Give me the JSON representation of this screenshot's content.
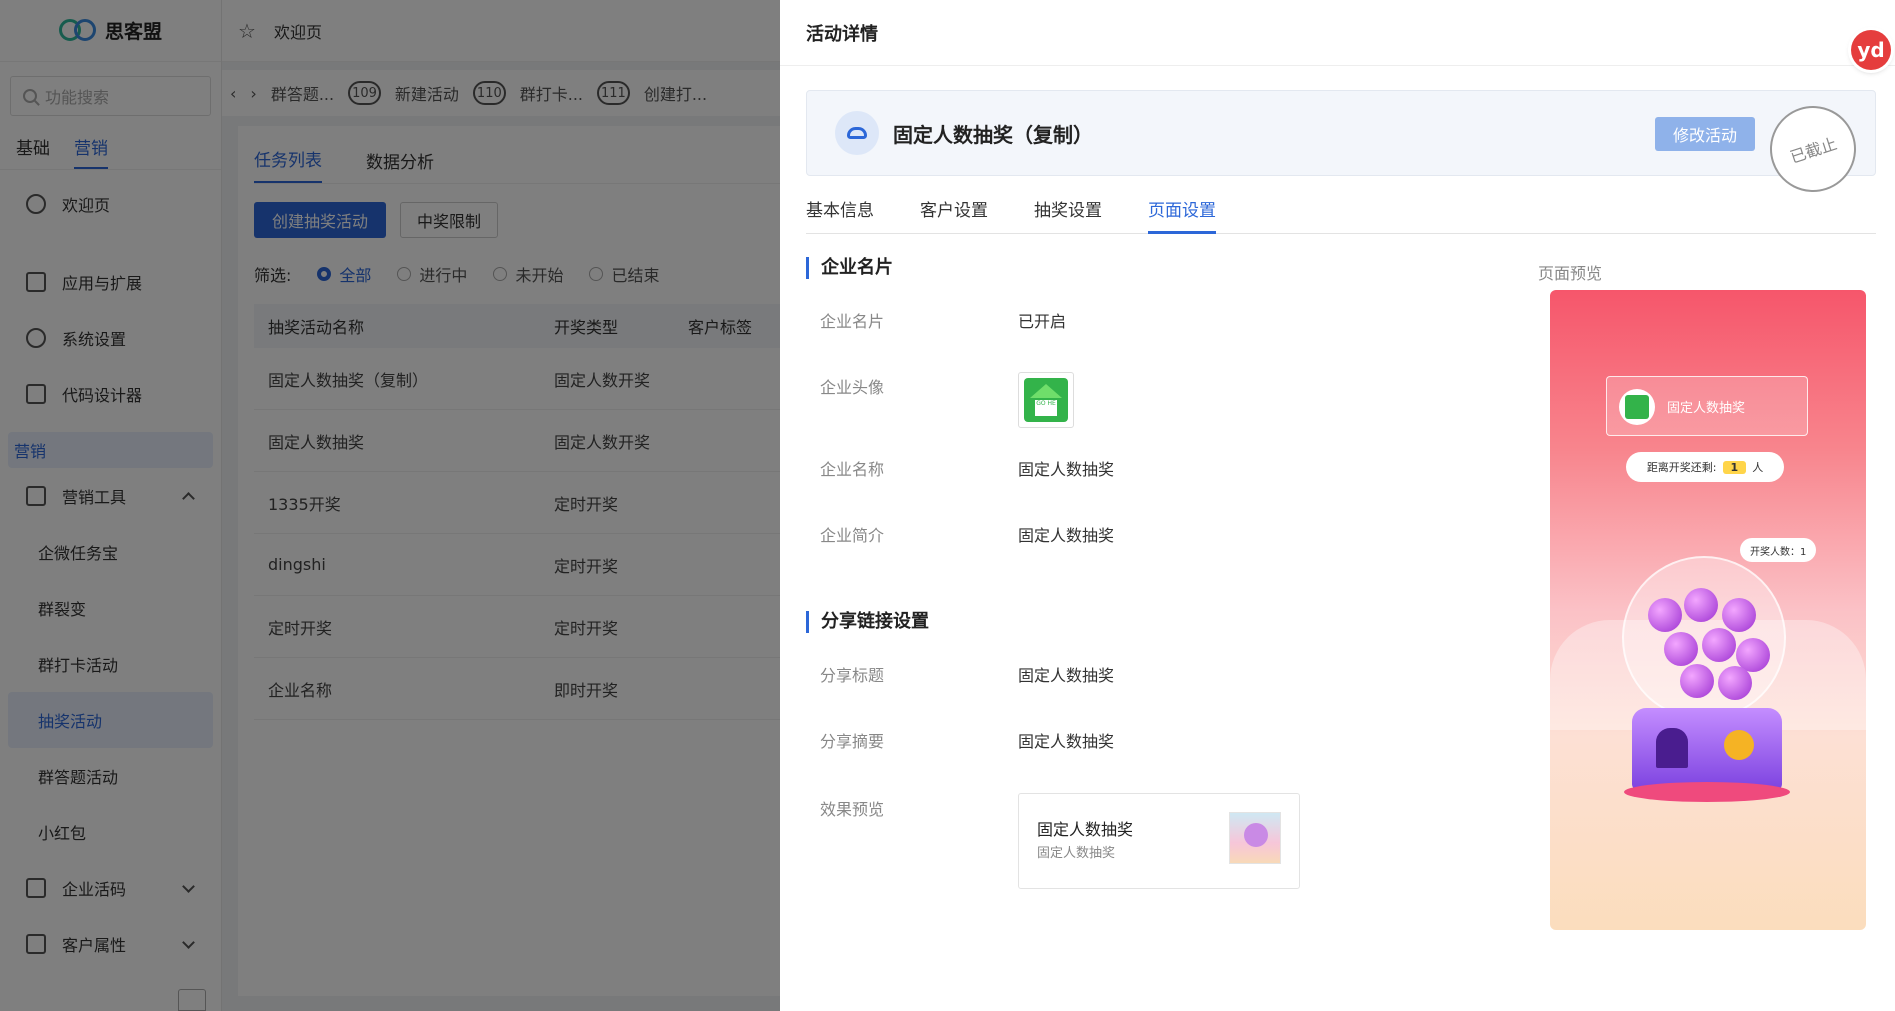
{
  "app": {
    "logo_text": "思客盟"
  },
  "sidebar": {
    "search_placeholder": "功能搜索",
    "tabs": [
      {
        "label": "基础"
      },
      {
        "label": "营销"
      }
    ],
    "welcome": "欢迎页",
    "items": [
      {
        "label": "应用与扩展"
      },
      {
        "label": "系统设置"
      },
      {
        "label": "代码设计器"
      }
    ],
    "group_label": "营销",
    "marketing_tools": "营销工具",
    "sub_items": [
      {
        "label": "企微任务宝"
      },
      {
        "label": "群裂变"
      },
      {
        "label": "群打卡活动"
      },
      {
        "label": "抽奖活动"
      },
      {
        "label": "群答题活动"
      },
      {
        "label": "小红包"
      }
    ],
    "enterprise_active": "企业活码",
    "customer_attr": "客户属性"
  },
  "topbar": {
    "welcome": "欢迎页"
  },
  "tabsbar": {
    "tabs": [
      {
        "label": "群答题...",
        "badge": "109"
      },
      {
        "label": "新建活动",
        "badge": "110"
      },
      {
        "label": "群打卡...",
        "badge": "111"
      },
      {
        "label": "创建打..."
      }
    ]
  },
  "list": {
    "tabs": [
      "任务列表",
      "数据分析"
    ],
    "create_button": "创建抽奖活动",
    "limit_button": "中奖限制",
    "filter_label": "筛选:",
    "filters": [
      "全部",
      "进行中",
      "未开始",
      "已结束"
    ],
    "headers": [
      "抽奖活动名称",
      "开奖类型",
      "客户标签"
    ],
    "rows": [
      [
        "固定人数抽奖（复制）",
        "固定人数开奖"
      ],
      [
        "固定人数抽奖",
        "固定人数开奖"
      ],
      [
        "1335开奖",
        "定时开奖"
      ],
      [
        "dingshi",
        "定时开奖"
      ],
      [
        "定时开奖",
        "定时开奖"
      ],
      [
        "企业名称",
        "即时开奖"
      ]
    ]
  },
  "drawer": {
    "title": "活动详情",
    "badge_text": "yd",
    "activity_name": "固定人数抽奖（复制）",
    "edit_button": "修改活动",
    "stamp": "已截止",
    "tabs": [
      "基本信息",
      "客户设置",
      "抽奖设置",
      "页面设置"
    ],
    "section_company": "企业名片",
    "company_fields": [
      {
        "label": "企业名片",
        "value": "已开启"
      },
      {
        "label": "企业头像",
        "value": ""
      },
      {
        "label": "企业名称",
        "value": "固定人数抽奖"
      },
      {
        "label": "企业简介",
        "value": "固定人数抽奖"
      }
    ],
    "section_share": "分享链接设置",
    "share_fields": [
      {
        "label": "分享标题",
        "value": "固定人数抽奖"
      },
      {
        "label": "分享摘要",
        "value": "固定人数抽奖"
      },
      {
        "label": "效果预览",
        "value": ""
      }
    ],
    "share_card": {
      "title": "固定人数抽奖",
      "summary": "固定人数抽奖"
    },
    "preview_label": "页面预览",
    "phone": {
      "name": "固定人数抽奖",
      "countdown_label": "距离开奖还剩:",
      "countdown_value": "1",
      "countdown_unit": "人",
      "draw_count": "开奖人数：1"
    }
  }
}
